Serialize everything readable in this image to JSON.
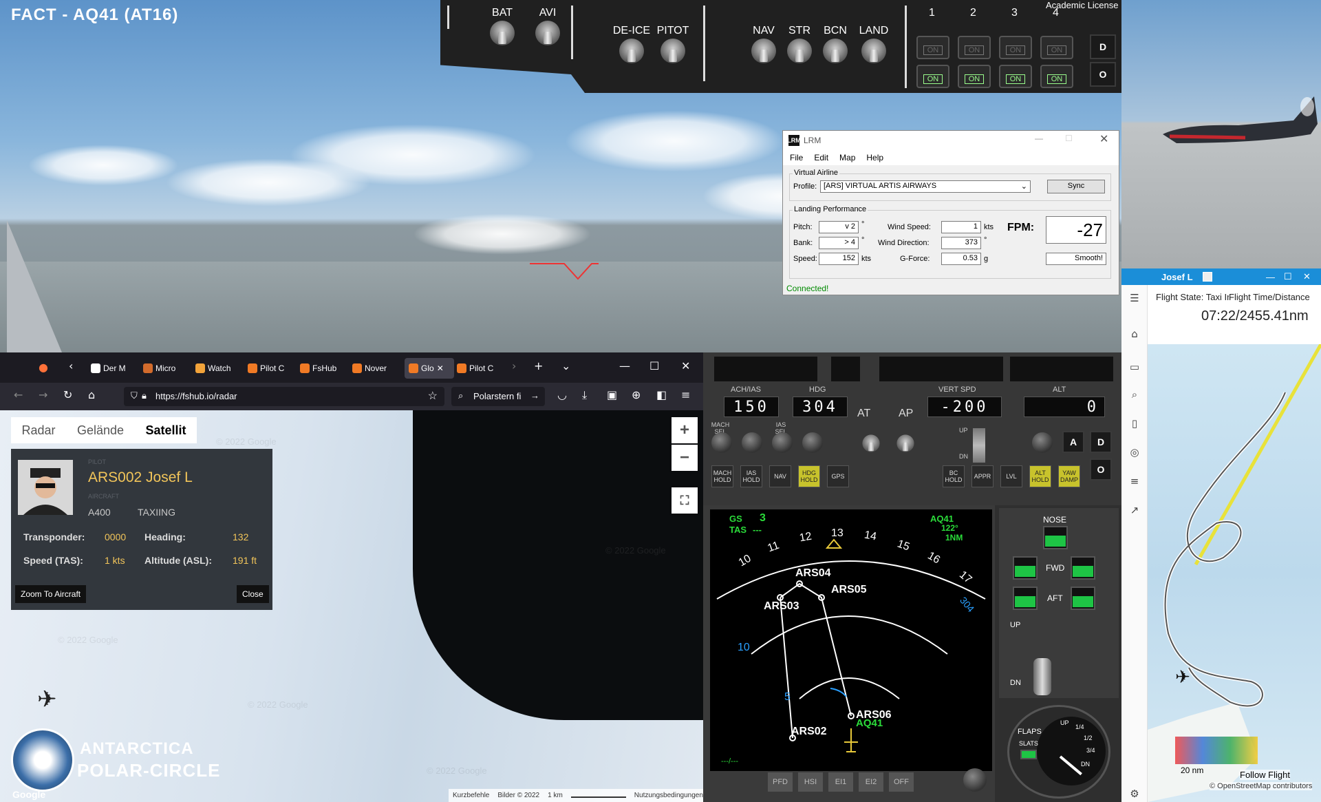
{
  "sim": {
    "title": "FACT - AQ41 (AT16)",
    "academic_license": "Academic License",
    "overhead": {
      "switches": [
        "BAT",
        "AVI",
        "DE-ICE",
        "PITOT",
        "NAV",
        "STR",
        "BCN",
        "LAND"
      ],
      "engine_numbers": [
        "1",
        "2",
        "3",
        "4"
      ],
      "on_label": "ON",
      "side_buttons": [
        "D",
        "O"
      ]
    }
  },
  "lrm": {
    "title": "LRM",
    "logo": "LRM",
    "menu": [
      "File",
      "Edit",
      "Map",
      "Help"
    ],
    "virtual_airline_label": "Virtual Airline",
    "profile_label": "Profile:",
    "profile_value": "[ARS] VIRTUAL ARTIS AIRWAYS",
    "sync_button": "Sync",
    "landing_performance_label": "Landing Performance",
    "pitch_label": "Pitch:",
    "pitch_value": "v 2",
    "bank_label": "Bank:",
    "bank_value": "> 4",
    "speed_label": "Speed:",
    "speed_value": "152",
    "speed_unit": "kts",
    "deg": "°",
    "wind_speed_label": "Wind Speed:",
    "wind_speed_value": "1",
    "wind_speed_unit": "kts",
    "wind_dir_label": "Wind Direction:",
    "wind_dir_value": "373",
    "gforce_label": "G-Force:",
    "gforce_value": "0.53",
    "gforce_unit": "g",
    "fpm_label": "FPM:",
    "fpm_value": "-27",
    "rating": "Smooth!",
    "status": "Connected!"
  },
  "acars": {
    "user": "Josef L",
    "flight_state": "Flight State: Taxi In",
    "flight_time_label": "Flight Time/Distance",
    "flight_time_value": "07:22/2455.41nm",
    "scale": "20 nm",
    "follow": "Follow Flight",
    "attribution": "© OpenStreetMap contributors"
  },
  "browser": {
    "tabs": [
      {
        "label": "Der M",
        "color": "#ffffff"
      },
      {
        "label": "Micro",
        "color": "#d26b2c"
      },
      {
        "label": "Watch",
        "color": "#f2a33a"
      },
      {
        "label": "Pilot C",
        "color": "#f07a25"
      },
      {
        "label": "FsHub",
        "color": "#f07a25"
      },
      {
        "label": "Nover",
        "color": "#f07a25"
      },
      {
        "label": "Glo",
        "color": "#f07a25"
      },
      {
        "label": "Pilot C",
        "color": "#f07a25"
      }
    ],
    "url": "https://fshub.io/radar",
    "search_text": "Polarstern fi",
    "map_types": [
      "Radar",
      "Gelände",
      "Satellit"
    ],
    "active_map_type": "Satellit",
    "pilot_card": {
      "pilot_caption": "PILOT",
      "name": "ARS002 Josef L",
      "aircraft_caption": "AIRCRAFT",
      "aircraft": "A400",
      "state": "TAXIING",
      "transponder_label": "Transponder:",
      "transponder": "0000",
      "heading_label": "Heading:",
      "heading": "132",
      "speed_label": "Speed (TAS):",
      "speed": "1 kts",
      "altitude_label": "Altitude (ASL):",
      "altitude": "191 ft",
      "zoom_button": "Zoom To Aircraft",
      "close_button": "Close"
    },
    "watermark": "© 2022 Google",
    "brand_line1": "ANTARCTICA",
    "brand_line2": "POLAR-CIRCLE",
    "google_logo": "Google",
    "footer": [
      "Kurzbefehle",
      "Bilder © 2022",
      "1 km",
      "Nutzungsbedingungen"
    ]
  },
  "autopilot": {
    "labels": {
      "ias": "ACH/IAS",
      "hdg": "HDG",
      "vs": "VERT SPD",
      "alt": "ALT",
      "at": "AT",
      "ap": "AP"
    },
    "ias": "150",
    "hdg": "304",
    "vs": "-200",
    "alt": "0",
    "knob_labels": [
      "MACH SEL",
      "IAS SEL"
    ],
    "buttons": [
      {
        "label": "MACH HOLD",
        "on": false
      },
      {
        "label": "IAS HOLD",
        "on": false
      },
      {
        "label": "NAV",
        "on": false
      },
      {
        "label": "HDG HOLD",
        "on": true
      },
      {
        "label": "GPS",
        "on": false
      },
      {
        "label": "BC HOLD",
        "on": false
      },
      {
        "label": "APPR",
        "on": false
      },
      {
        "label": "LVL",
        "on": false
      },
      {
        "label": "ALT HOLD",
        "on": true
      },
      {
        "label": "YAW DAMP",
        "on": true
      }
    ],
    "vs_up": "UP",
    "vs_dn": "DN",
    "side_buttons": [
      "A",
      "D",
      "O"
    ]
  },
  "nd": {
    "gs_label": "GS",
    "gs": "3",
    "tas_label": "TAS",
    "tas": "---",
    "wpt": "AQ41",
    "wpt_brg": "122°",
    "wpt_dist": "1NM",
    "hdg_scale": [
      "10",
      "11",
      "12",
      "13",
      "14",
      "15",
      "16",
      "17"
    ],
    "sel_hdg": "304",
    "ranges": [
      "10",
      "5"
    ],
    "waypoints": [
      "ARS04",
      "ARS03",
      "ARS05",
      "ARS06",
      "ARS02",
      "AQ41"
    ],
    "bottom_left": "---/---",
    "buttons": [
      "PFD",
      "HSI",
      "EI1",
      "EI2",
      "OFF"
    ]
  },
  "gear": {
    "nose": "NOSE",
    "fwd": "FWD",
    "aft": "AFT",
    "up": "UP",
    "dn": "DN",
    "flaps": "FLAPS",
    "slats": "SLATS",
    "flap_marks": [
      "UP",
      "1/4",
      "1/2",
      "3/4",
      "DN"
    ]
  }
}
